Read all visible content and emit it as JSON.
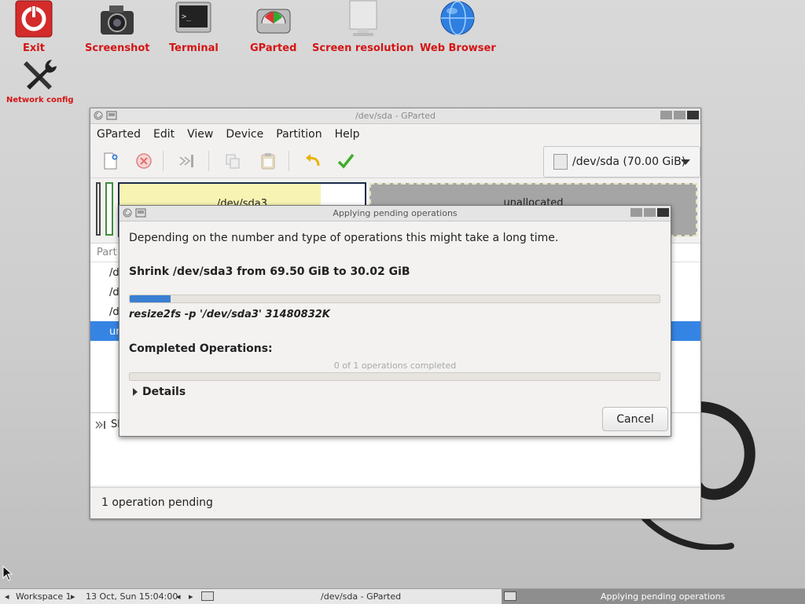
{
  "desktop": {
    "icons": [
      {
        "label": "Exit",
        "icon": "power-icon"
      },
      {
        "label": "Screenshot",
        "icon": "camera-icon"
      },
      {
        "label": "Terminal",
        "icon": "terminal-icon"
      },
      {
        "label": "GParted",
        "icon": "gparted-icon"
      },
      {
        "label": "Screen resolution",
        "icon": "monitor-icon"
      },
      {
        "label": "Web Browser",
        "icon": "globe-icon"
      },
      {
        "label": "Network config",
        "icon": "tools-icon"
      }
    ]
  },
  "gparted": {
    "title": "/dev/sda - GParted",
    "menu": [
      "GParted",
      "Edit",
      "View",
      "Device",
      "Partition",
      "Help"
    ],
    "toolbar_icons": [
      "new-icon",
      "delete-icon",
      "resize-icon",
      "copy-icon",
      "paste-icon",
      "undo-icon",
      "apply-icon"
    ],
    "device": "/dev/sda (70.00 GiB)",
    "partitions_visual": {
      "sda3": "/dev/sda3",
      "unallocated": "unallocated"
    },
    "list": {
      "header": "Part",
      "rows": [
        "/d",
        "/d",
        "/d",
        "ur"
      ],
      "selected_row": 3
    },
    "operation_item": "Sh",
    "status": "1 operation pending"
  },
  "dialog": {
    "title": "Applying pending operations",
    "message": "Depending on the number and type of operations this might take a long time.",
    "operation": "Shrink /dev/sda3 from 69.50 GiB to 30.02 GiB",
    "progress": 0.077,
    "command": "resize2fs -p '/dev/sda3' 31480832K",
    "completed_label": "Completed Operations:",
    "completed_count": "0 of 1 operations completed",
    "completed_progress": 0,
    "details_label": "Details",
    "cancel_label": "Cancel"
  },
  "taskbar": {
    "workspace": "Workspace 1",
    "datetime": "13 Oct, Sun 15:04:00",
    "task_gparted": "/dev/sda - GParted",
    "task_applying": "Applying pending operations"
  }
}
